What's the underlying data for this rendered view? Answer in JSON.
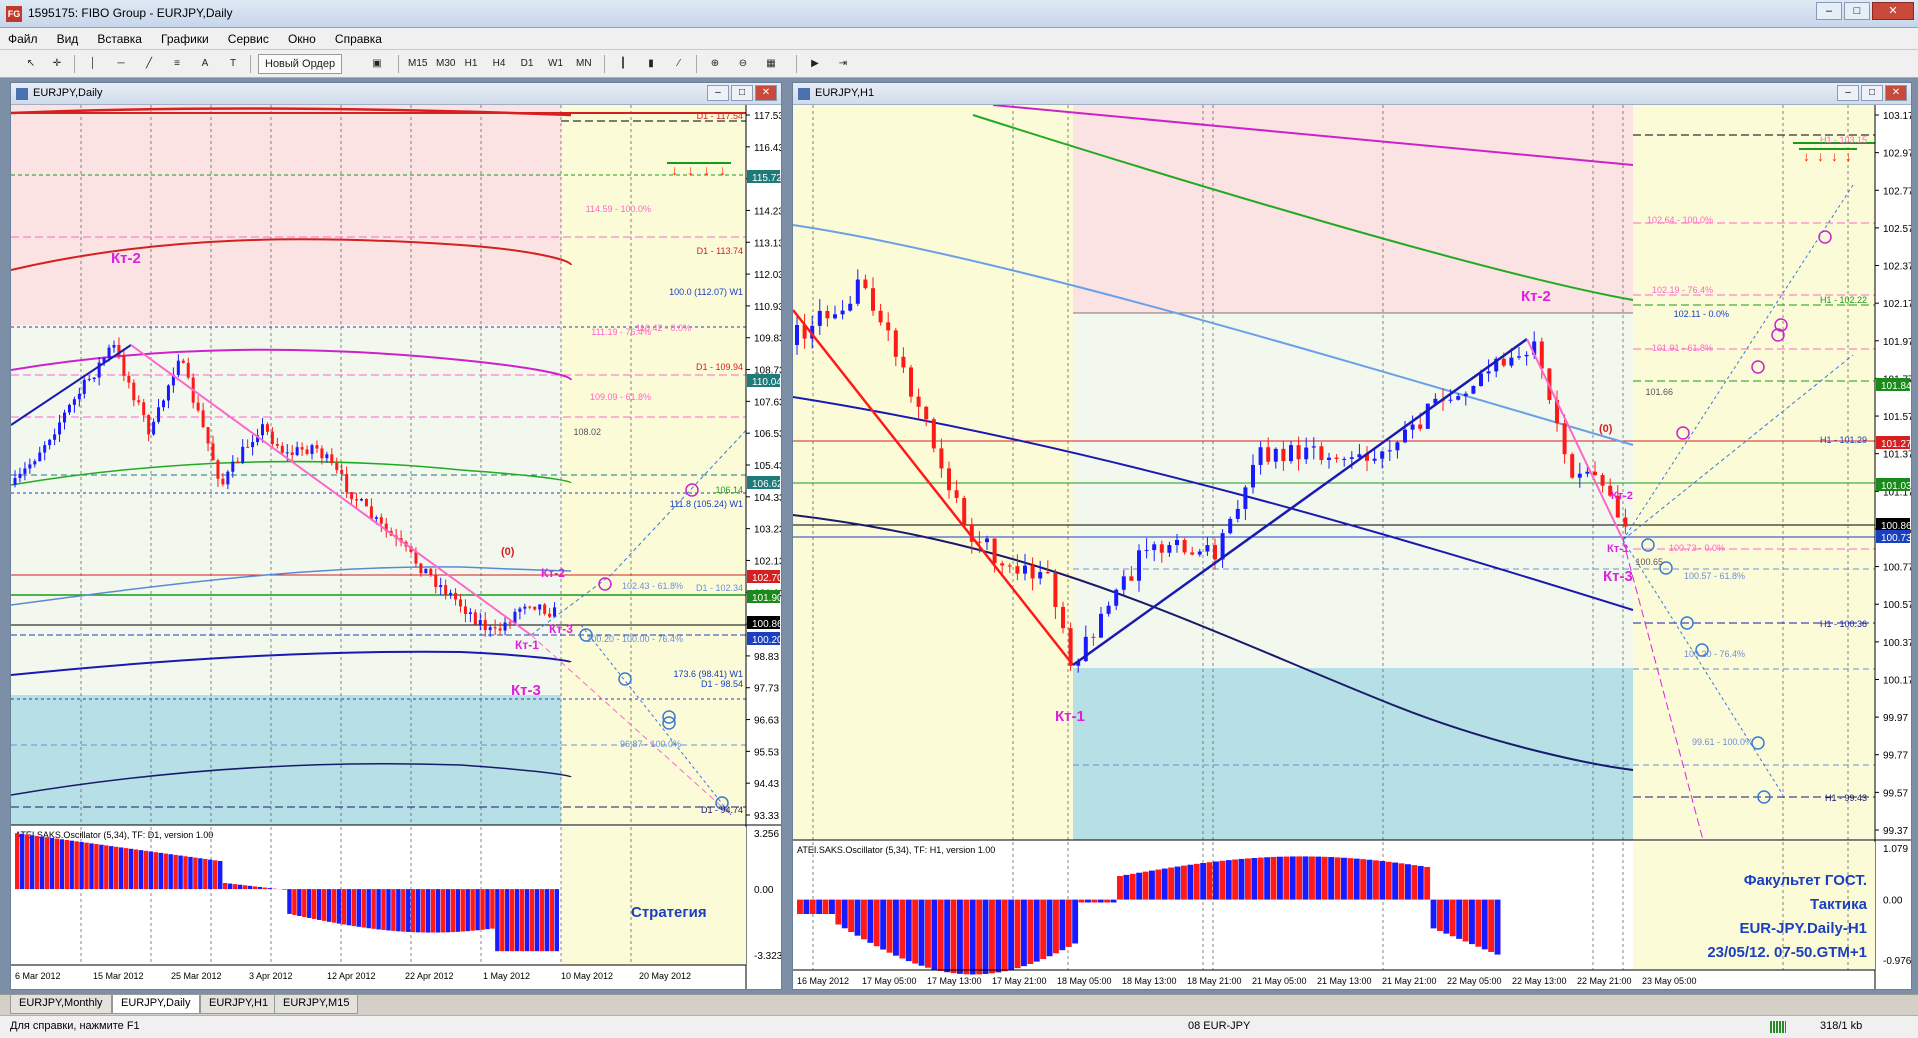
{
  "window": {
    "title": "1595175: FIBO Group - EURJPY,Daily",
    "icon_label": "FG",
    "minimize": "–",
    "maximize": "□",
    "close": "✕"
  },
  "menu": [
    "Файл",
    "Вид",
    "Вставка",
    "Графики",
    "Сервис",
    "Окно",
    "Справка"
  ],
  "toolbar": {
    "new_order": "Новый Ордер",
    "timeframes": [
      "M15",
      "M30",
      "H1",
      "H4",
      "D1",
      "W1",
      "MN"
    ]
  },
  "left_chart": {
    "title": "EURJPY,Daily",
    "price_scale": [
      "117.53",
      "116.43",
      "115.33",
      "114.23",
      "113.13",
      "112.03",
      "110.93",
      "109.83",
      "108.73",
      "107.63",
      "106.53",
      "105.43",
      "104.33",
      "103.23",
      "102.13",
      "101.03",
      "99.93",
      "98.83",
      "97.73",
      "96.63",
      "95.53",
      "94.43",
      "93.33"
    ],
    "price_tags": [
      {
        "text": "115.72",
        "color": "#1f7a7a"
      },
      {
        "text": "110.04",
        "color": "#1f7a7a"
      },
      {
        "text": "106.62",
        "color": "#1f7a7a"
      },
      {
        "text": "102.70",
        "color": "#d42020"
      },
      {
        "text": "101.90",
        "color": "#1a8a1a"
      },
      {
        "text": "100.86",
        "color": "#000000"
      },
      {
        "text": "100.20",
        "color": "#1a3fbf"
      }
    ],
    "level_labels": [
      "D1 - 117.54",
      "114.59 - 100.0%",
      "D1 - 113.74",
      "100.0 (112.07) W1",
      "111.19 - 76.4%",
      "110.42 - 0.0%",
      "D1 - 109.94",
      "109.09 - 61.8%",
      "108.02",
      "106.14",
      "111.8 (105.24) W1",
      "102.43 - 61.8%",
      "D1 - 102.34",
      "100.20 - 100.00 - 76.4%",
      "173.6 (98.41) W1",
      "D1 - 98.54",
      "96.87 - 100.0%",
      "D1 - 94.74"
    ],
    "annotations": {
      "kt2_top": "Кт-2",
      "kt2_low": "Кт-2",
      "kt1": "Кт-1",
      "kt3_a": "Кт-3",
      "kt3_b": "Кт-3",
      "zero": "(0)"
    },
    "dates": [
      "6 Mar 2012",
      "15 Mar 2012",
      "25 Mar 2012",
      "3 Apr 2012",
      "12 Apr 2012",
      "22 Apr 2012",
      "1 May 2012",
      "10 May 2012",
      "20 May 2012"
    ],
    "oscillator": {
      "label": "ATEI.SAKS.Oscillator (5,34), TF: D1, version 1.00",
      "scale": [
        "3.256",
        "0.00",
        "-3.323"
      ],
      "strategy_label": "Стратегия"
    }
  },
  "right_chart": {
    "title": "EURJPY,H1",
    "price_scale": [
      "103.17",
      "102.97",
      "102.77",
      "102.57",
      "102.37",
      "102.17",
      "101.97",
      "101.77",
      "101.57",
      "101.37",
      "101.17",
      "100.97",
      "100.77",
      "100.57",
      "100.37",
      "100.17",
      "99.97",
      "99.77",
      "99.57",
      "99.37"
    ],
    "price_tags": [
      {
        "text": "101.84",
        "color": "#1a8a1a"
      },
      {
        "text": "101.27",
        "color": "#d42020"
      },
      {
        "text": "101.03",
        "color": "#1a8a1a"
      },
      {
        "text": "100.86",
        "color": "#000000"
      },
      {
        "text": "100.73",
        "color": "#1a3fbf"
      }
    ],
    "level_labels": [
      "H1 - 103.15",
      "102.64 - 100.0%",
      "102.19 - 76.4%",
      "H1 - 102.22",
      "102.11 - 0.0%",
      "101.91 - 61.8%",
      "101.66",
      "H1 - 101.29",
      "100.73 - 0.0%",
      "100.65",
      "100.57 - 61.8%",
      "H1 - 100.36",
      "100.20 - 76.4%",
      "99.61 - 100.0%",
      "H1 - 99.43"
    ],
    "annotations": {
      "kt2": "Кт-2",
      "kt1": "Кт-1",
      "kt3": "Кт-3",
      "kt2_small": "Кт-2",
      "kt1_small": "Кт-1",
      "zero": "(0)"
    },
    "dates": [
      "16 May 2012",
      "17 May 05:00",
      "17 May 13:00",
      "17 May 21:00",
      "18 May 05:00",
      "18 May 13:00",
      "18 May 21:00",
      "21 May 05:00",
      "21 May 13:00",
      "21 May 21:00",
      "22 May 05:00",
      "22 May 13:00",
      "22 May 21:00",
      "23 May 05:00"
    ],
    "oscillator": {
      "label": "ATEI.SAKS.Oscillator (5,34), TF: H1, version 1.00",
      "scale": [
        "1.079",
        "0.00",
        "-0.976"
      ]
    },
    "info_lines": [
      "Факультет ГОСТ.",
      "Тактика",
      "EUR-JPY.Daily-H1",
      "23/05/12. 07-50.GTM+1"
    ]
  },
  "tabs": [
    "EURJPY,Monthly",
    "EURJPY,Daily",
    "EURJPY,H1",
    "EURJPY,M15"
  ],
  "active_tab": 1,
  "status": {
    "help": "Для справки, нажмите F1",
    "profile": "08 EUR-JPY",
    "traffic": "318/1 kb"
  },
  "colors": {
    "bull": "#1a1aff",
    "bear": "#ff1a1a",
    "pink_zone": "#fbe3e3",
    "yellow_zone": "#fbfbd8",
    "cyan_zone": "#b6e0e6",
    "light_zone": "#f2f8ee"
  }
}
